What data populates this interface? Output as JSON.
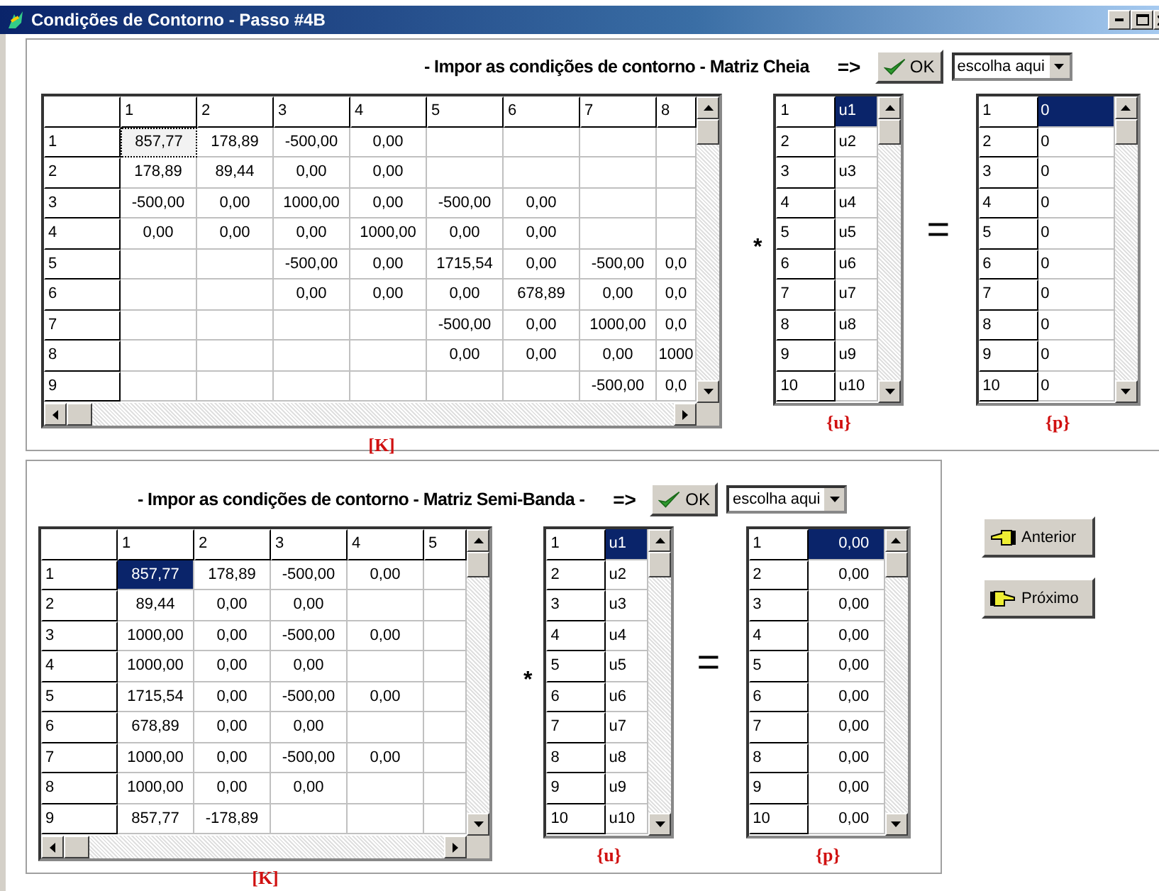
{
  "window": {
    "title": "Condições de Contorno - Passo #4B"
  },
  "panels": [
    {
      "heading": "- Impor as condições de contorno - Matriz Cheia",
      "arrow": "=>",
      "ok_button": "OK",
      "dropdown": "escolha aqui",
      "matrix": {
        "label": "[K]",
        "columns": [
          "1",
          "2",
          "3",
          "4",
          "5",
          "6",
          "7",
          "8"
        ],
        "rows": [
          {
            "header": "1",
            "cells": [
              {
                "text": "857,77",
                "focused": true
              },
              {
                "text": "178,89",
                "focused": false
              },
              {
                "text": "-500,00",
                "focused": false
              },
              {
                "text": "0,00",
                "focused": false
              },
              {
                "focused": false
              },
              {
                "focused": false
              },
              {
                "focused": false
              },
              {
                "focused": false
              }
            ]
          },
          {
            "header": "2",
            "cells": [
              {
                "text": "178,89",
                "focused": false
              },
              {
                "text": "89,44",
                "focused": false
              },
              {
                "text": "0,00",
                "focused": false
              },
              {
                "text": "0,00",
                "focused": false
              },
              {
                "focused": false
              },
              {
                "focused": false
              },
              {
                "focused": false
              },
              {
                "focused": false
              }
            ]
          },
          {
            "header": "3",
            "cells": [
              {
                "text": "-500,00",
                "focused": false
              },
              {
                "text": "0,00",
                "focused": false
              },
              {
                "text": "1000,00",
                "focused": false
              },
              {
                "text": "0,00",
                "focused": false
              },
              {
                "text": "-500,00",
                "focused": false
              },
              {
                "text": "0,00",
                "focused": false
              },
              {
                "focused": false
              },
              {
                "focused": false
              }
            ]
          },
          {
            "header": "4",
            "cells": [
              {
                "text": "0,00",
                "focused": false
              },
              {
                "text": "0,00",
                "focused": false
              },
              {
                "text": "0,00",
                "focused": false
              },
              {
                "text": "1000,00",
                "focused": false
              },
              {
                "text": "0,00",
                "focused": false
              },
              {
                "text": "0,00",
                "focused": false
              },
              {
                "focused": false
              },
              {
                "focused": false
              }
            ]
          },
          {
            "header": "5",
            "cells": [
              {
                "focused": false
              },
              {
                "focused": false
              },
              {
                "text": "-500,00",
                "focused": false
              },
              {
                "text": "0,00",
                "focused": false
              },
              {
                "text": "1715,54",
                "focused": false
              },
              {
                "text": "0,00",
                "focused": false
              },
              {
                "text": "-500,00",
                "focused": false
              },
              {
                "text": "0,0",
                "focused": false
              }
            ]
          },
          {
            "header": "6",
            "cells": [
              {
                "focused": false
              },
              {
                "focused": false
              },
              {
                "text": "0,00",
                "focused": false
              },
              {
                "text": "0,00",
                "focused": false
              },
              {
                "text": "0,00",
                "focused": false
              },
              {
                "text": "678,89",
                "focused": false
              },
              {
                "text": "0,00",
                "focused": false
              },
              {
                "text": "0,0",
                "focused": false
              }
            ]
          },
          {
            "header": "7",
            "cells": [
              {
                "focused": false
              },
              {
                "focused": false
              },
              {
                "focused": false
              },
              {
                "focused": false
              },
              {
                "text": "-500,00",
                "focused": false
              },
              {
                "text": "0,00",
                "focused": false
              },
              {
                "text": "1000,00",
                "focused": false
              },
              {
                "text": "0,0",
                "focused": false
              }
            ]
          },
          {
            "header": "8",
            "cells": [
              {
                "focused": false
              },
              {
                "focused": false
              },
              {
                "focused": false
              },
              {
                "focused": false
              },
              {
                "text": "0,00",
                "focused": false
              },
              {
                "text": "0,00",
                "focused": false
              },
              {
                "text": "0,00",
                "focused": false
              },
              {
                "text": "1000",
                "focused": false
              }
            ]
          },
          {
            "header": "9",
            "cells": [
              {
                "focused": false
              },
              {
                "focused": false
              },
              {
                "focused": false
              },
              {
                "focused": false
              },
              {
                "focused": false
              },
              {
                "focused": false
              },
              {
                "text": "-500,00",
                "focused": false
              },
              {
                "text": "0,0",
                "focused": false
              }
            ]
          }
        ]
      },
      "operator": "*",
      "equals": "=",
      "u_vector": {
        "label": "{u}",
        "rows": [
          {
            "index": "1",
            "value": "u1",
            "selected": true
          },
          {
            "index": "2",
            "value": "u2",
            "selected": false
          },
          {
            "index": "3",
            "value": "u3",
            "selected": false
          },
          {
            "index": "4",
            "value": "u4",
            "selected": false
          },
          {
            "index": "5",
            "value": "u5",
            "selected": false
          },
          {
            "index": "6",
            "value": "u6",
            "selected": false
          },
          {
            "index": "7",
            "value": "u7",
            "selected": false
          },
          {
            "index": "8",
            "value": "u8",
            "selected": false
          },
          {
            "index": "9",
            "value": "u9",
            "selected": false
          },
          {
            "index": "10",
            "value": "u10",
            "selected": false
          }
        ]
      },
      "p_vector": {
        "label": "{p}",
        "rows": [
          {
            "index": "1",
            "value": "0",
            "selected": true
          },
          {
            "index": "2",
            "value": "0",
            "selected": false
          },
          {
            "index": "3",
            "value": "0",
            "selected": false
          },
          {
            "index": "4",
            "value": "0",
            "selected": false
          },
          {
            "index": "5",
            "value": "0",
            "selected": false
          },
          {
            "index": "6",
            "value": "0",
            "selected": false
          },
          {
            "index": "7",
            "value": "0",
            "selected": false
          },
          {
            "index": "8",
            "value": "0",
            "selected": false
          },
          {
            "index": "9",
            "value": "0",
            "selected": false
          },
          {
            "index": "10",
            "value": "0",
            "selected": false
          }
        ]
      }
    },
    {
      "heading": "- Impor as condições de contorno - Matriz Semi-Banda -",
      "arrow": "=>",
      "ok_button": "OK",
      "dropdown": "escolha aqui",
      "matrix": {
        "label": "[K]",
        "columns": [
          "1",
          "2",
          "3",
          "4",
          "5"
        ],
        "rows": [
          {
            "header": "1",
            "cells": [
              {
                "text": "857,77",
                "focused": true
              },
              {
                "text": "178,89",
                "focused": false
              },
              {
                "text": "-500,00",
                "focused": false
              },
              {
                "text": "0,00",
                "focused": false
              },
              {
                "focused": false
              }
            ]
          },
          {
            "header": "2",
            "cells": [
              {
                "text": "89,44",
                "focused": false
              },
              {
                "text": "0,00",
                "focused": false
              },
              {
                "text": "0,00",
                "focused": false
              },
              {
                "focused": false
              },
              {
                "focused": false
              }
            ]
          },
          {
            "header": "3",
            "cells": [
              {
                "text": "1000,00",
                "focused": false
              },
              {
                "text": "0,00",
                "focused": false
              },
              {
                "text": "-500,00",
                "focused": false
              },
              {
                "text": "0,00",
                "focused": false
              },
              {
                "focused": false
              }
            ]
          },
          {
            "header": "4",
            "cells": [
              {
                "text": "1000,00",
                "focused": false
              },
              {
                "text": "0,00",
                "focused": false
              },
              {
                "text": "0,00",
                "focused": false
              },
              {
                "focused": false
              },
              {
                "focused": false
              }
            ]
          },
          {
            "header": "5",
            "cells": [
              {
                "text": "1715,54",
                "focused": false
              },
              {
                "text": "0,00",
                "focused": false
              },
              {
                "text": "-500,00",
                "focused": false
              },
              {
                "text": "0,00",
                "focused": false
              },
              {
                "focused": false
              }
            ]
          },
          {
            "header": "6",
            "cells": [
              {
                "text": "678,89",
                "focused": false
              },
              {
                "text": "0,00",
                "focused": false
              },
              {
                "text": "0,00",
                "focused": false
              },
              {
                "focused": false
              },
              {
                "focused": false
              }
            ]
          },
          {
            "header": "7",
            "cells": [
              {
                "text": "1000,00",
                "focused": false
              },
              {
                "text": "0,00",
                "focused": false
              },
              {
                "text": "-500,00",
                "focused": false
              },
              {
                "text": "0,00",
                "focused": false
              },
              {
                "focused": false
              }
            ]
          },
          {
            "header": "8",
            "cells": [
              {
                "text": "1000,00",
                "focused": false
              },
              {
                "text": "0,00",
                "focused": false
              },
              {
                "text": "0,00",
                "focused": false
              },
              {
                "focused": false
              },
              {
                "focused": false
              }
            ]
          },
          {
            "header": "9",
            "cells": [
              {
                "text": "857,77",
                "focused": false
              },
              {
                "text": "-178,89",
                "focused": false
              },
              {
                "focused": false
              },
              {
                "focused": false
              },
              {
                "focused": false
              }
            ]
          }
        ]
      },
      "operator": "*",
      "equals": "=",
      "u_vector": {
        "label": "{u}",
        "rows": [
          {
            "index": "1",
            "value": "u1",
            "selected": true
          },
          {
            "index": "2",
            "value": "u2",
            "selected": false
          },
          {
            "index": "3",
            "value": "u3",
            "selected": false
          },
          {
            "index": "4",
            "value": "u4",
            "selected": false
          },
          {
            "index": "5",
            "value": "u5",
            "selected": false
          },
          {
            "index": "6",
            "value": "u6",
            "selected": false
          },
          {
            "index": "7",
            "value": "u7",
            "selected": false
          },
          {
            "index": "8",
            "value": "u8",
            "selected": false
          },
          {
            "index": "9",
            "value": "u9",
            "selected": false
          },
          {
            "index": "10",
            "value": "u10",
            "selected": false
          }
        ]
      },
      "p_vector": {
        "label": "{p}",
        "rows": [
          {
            "index": "1",
            "value": "0,00",
            "selected": true
          },
          {
            "index": "2",
            "value": "0,00",
            "selected": false
          },
          {
            "index": "3",
            "value": "0,00",
            "selected": false
          },
          {
            "index": "4",
            "value": "0,00",
            "selected": false
          },
          {
            "index": "5",
            "value": "0,00",
            "selected": false
          },
          {
            "index": "6",
            "value": "0,00",
            "selected": false
          },
          {
            "index": "7",
            "value": "0,00",
            "selected": false
          },
          {
            "index": "8",
            "value": "0,00",
            "selected": false
          },
          {
            "index": "9",
            "value": "0,00",
            "selected": false
          },
          {
            "index": "10",
            "value": "0,00",
            "selected": false
          }
        ]
      }
    }
  ],
  "nav_buttons": [
    "Anterior",
    "Próximo"
  ]
}
